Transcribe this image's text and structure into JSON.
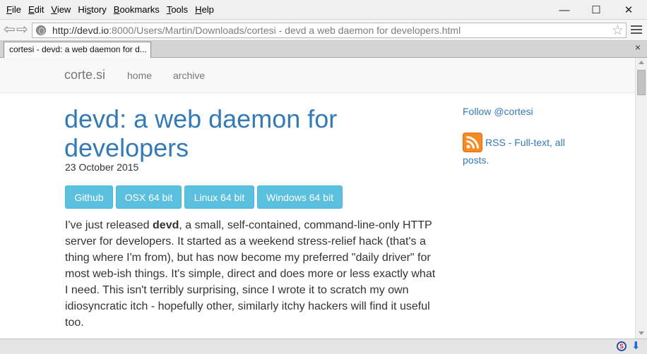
{
  "menubar": {
    "items": [
      {
        "ul": "F",
        "rest": "ile"
      },
      {
        "ul": "E",
        "rest": "dit"
      },
      {
        "ul": "V",
        "rest": "iew"
      },
      {
        "ul": "",
        "pre": "Hi",
        "ul2": "s",
        "rest": "tory"
      },
      {
        "ul": "B",
        "rest": "ookmarks"
      },
      {
        "ul": "T",
        "rest": "ools"
      },
      {
        "ul": "H",
        "rest": "elp"
      }
    ]
  },
  "window_controls": {
    "minimize": "—",
    "maximize": "☐",
    "close": "✕"
  },
  "toolbar": {
    "back": "⇦",
    "forward": "⇨",
    "url_host": "http://devd.io",
    "url_rest": ":8000/Users/Martin/Downloads/cortesi - devd  a web daemon for developers.html",
    "bookmark_star": "☆"
  },
  "tab": {
    "title": "cortesi - devd: a web daemon for d...",
    "close": "×"
  },
  "tabbar_close": "×",
  "site": {
    "brand": "corte.si",
    "nav": [
      "home",
      "archive"
    ]
  },
  "post": {
    "title": "devd: a web daemon for developers",
    "date": "23 October 2015",
    "buttons": [
      "Github",
      "OSX 64 bit",
      "Linux 64 bit",
      "Windows 64 bit"
    ],
    "body_pre": "I've just released ",
    "body_bold": "devd",
    "body_post": ", a small, self-contained, command-line-only HTTP server for developers. It started as a weekend stress-relief hack (that's a thing where I'm from), but has now become my preferred \"daily driver\" for most web-ish things. It's simple, direct and does more or less exactly what I need. This isn't terribly surprising, since I wrote it to scratch my own idiosyncratic itch - hopefully other, similarly itchy hackers will find it useful too."
  },
  "sidebar": {
    "follow": "Follow @cortesi",
    "rss": "RSS - Full-text, all posts."
  },
  "colors": {
    "link": "#337ab7",
    "button_info": "#5bc0de",
    "rss": "#f78a22"
  }
}
